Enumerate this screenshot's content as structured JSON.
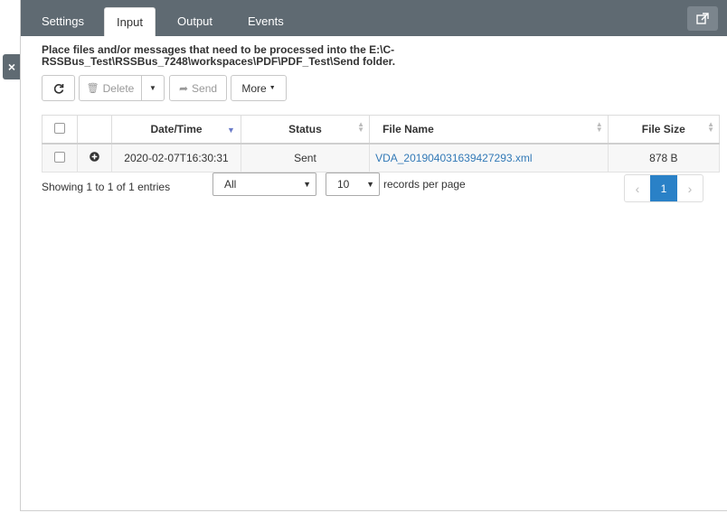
{
  "tabs": [
    {
      "label": "Settings"
    },
    {
      "label": "Input"
    },
    {
      "label": "Output"
    },
    {
      "label": "Events"
    }
  ],
  "active_tab": "Input",
  "description": "Place files and/or messages that need to be processed into the E:\\C-RSSBus_Test\\RSSBus_7248\\workspaces\\PDF\\PDF_Test\\Send folder.",
  "toolbar": {
    "delete_label": "Delete",
    "send_label": "Send",
    "more_label": "More"
  },
  "table": {
    "columns": [
      "Date/Time",
      "Status",
      "File Name",
      "File Size"
    ],
    "rows": [
      {
        "datetime": "2020-02-07T16:30:31",
        "status": "Sent",
        "filename": "VDA_201904031639427293.xml",
        "filesize": "878 B"
      }
    ]
  },
  "footer": {
    "info": "Showing 1 to 1 of 1 entries",
    "filter_value": "All",
    "page_size_value": "10",
    "records_label": "records per page",
    "current_page": "1"
  },
  "colors": {
    "tabbar": "#5f6a72",
    "accent": "#2a81c7",
    "link": "#337ab7"
  }
}
